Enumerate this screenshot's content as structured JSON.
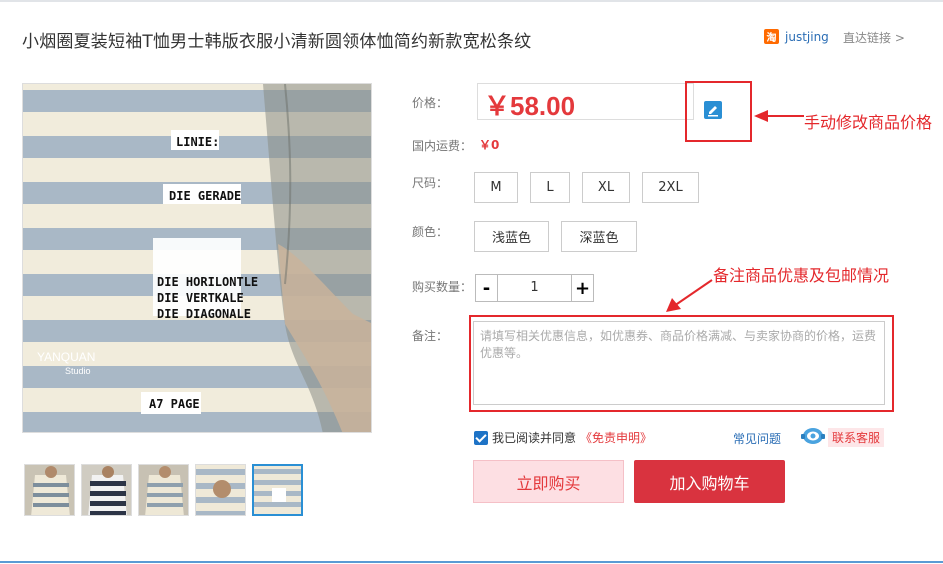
{
  "header": {
    "title": "小烟圈夏装短袖T恤男士韩版衣服小清新圆领体恤简约新款宽松条纹",
    "shop_icon_char": "淘",
    "shop_name": "justjing",
    "direct_link": "直达链接 >"
  },
  "product_image": {
    "labels": [
      "LINIE:",
      "DIE GERADE",
      "DIE HORILONTLE",
      "DIE VERTKALE",
      "DIE DIAGONALE",
      "A7 PAGE"
    ],
    "watermark_main": "YANQUAN",
    "watermark_sub": "Studio"
  },
  "thumbnails": [
    {
      "name": "thumb-1",
      "active": false
    },
    {
      "name": "thumb-2",
      "active": false
    },
    {
      "name": "thumb-3",
      "active": false
    },
    {
      "name": "thumb-4",
      "active": false
    },
    {
      "name": "thumb-5",
      "active": true
    }
  ],
  "form": {
    "price_label": "价格：",
    "price_value": "￥58.00",
    "shipping_label": "国内运费：",
    "shipping_value": "￥0",
    "size_label": "尺码：",
    "sizes": [
      "M",
      "L",
      "XL",
      "2XL"
    ],
    "color_label": "颜色：",
    "colors": [
      "浅蓝色",
      "深蓝色"
    ],
    "qty_label": "购买数量：",
    "qty_minus": "-",
    "qty_value": "1",
    "qty_plus": "+",
    "note_label": "备注：",
    "note_placeholder": "请填写相关优惠信息，如优惠券、商品价格满减、与卖家协商的价格，运费优惠等。"
  },
  "agreement": {
    "text": "我已阅读并同意",
    "link": "《免责申明》",
    "checked": true
  },
  "links": {
    "faq": "常见问题",
    "service": "联系客服"
  },
  "buttons": {
    "buy_now": "立即购买",
    "add_cart": "加入购物车"
  },
  "annotations": {
    "price_note": "手动修改商品价格",
    "discount_note": "备注商品优惠及包邮情况"
  },
  "colors": {
    "accent_red": "#e4393c",
    "link_blue": "#2a6db5",
    "annotation_red": "#e4282c"
  }
}
